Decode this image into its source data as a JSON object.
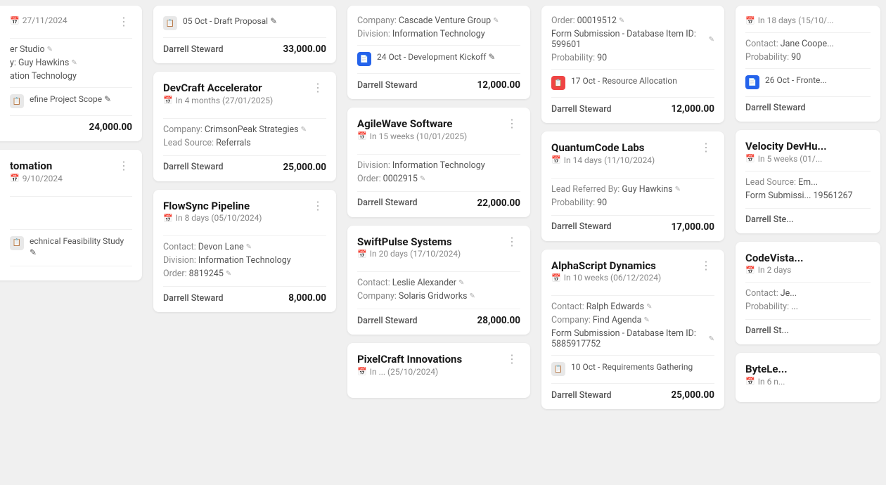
{
  "columns": [
    {
      "id": "col1",
      "partial": "left",
      "cards": [
        {
          "id": "c1",
          "title": "...",
          "subtitle": "27/11/2024",
          "fields": [
            {
              "label": "er Studio",
              "edit": true
            },
            {
              "label": "y: Guy Hawkins",
              "edit": true
            },
            {
              "label": "ation Technology"
            }
          ],
          "activity": [],
          "activities": [
            {
              "icon": "gray",
              "text": "efine Project Scope",
              "edit": true
            }
          ],
          "owner": "",
          "amount": "24,000.00",
          "more": true
        },
        {
          "id": "c2",
          "title": "tomation",
          "subtitle": "9/10/2024",
          "fields": [],
          "activities": [
            {
              "icon": "gray",
              "text": "echnical Feasibility Study",
              "edit": true
            }
          ],
          "owner": "",
          "amount": "",
          "more": true
        }
      ]
    },
    {
      "id": "col2",
      "partial": "none",
      "cards": [
        {
          "id": "c3",
          "title": "...",
          "subtitle": "",
          "activities": [
            {
              "icon": "gray",
              "text": "05 Oct - Draft Proposal",
              "edit": true
            }
          ],
          "fields": [],
          "owner": "Darrell Steward",
          "amount": "33,000.00",
          "more": false
        },
        {
          "id": "c4",
          "title": "DevCraft Accelerator",
          "subtitle": "In 4 months (27/01/2025)",
          "subtitleIcon": "calendar",
          "fields": [
            {
              "label": "Company:",
              "value": "CrimsonPeak Strategies",
              "edit": true
            },
            {
              "label": "Lead Source:",
              "value": "Referrals",
              "edit": false
            }
          ],
          "activities": [],
          "owner": "Darrell Steward",
          "amount": "25,000.00",
          "more": true
        },
        {
          "id": "c5",
          "title": "FlowSync Pipeline",
          "subtitle": "In 8 days (05/10/2024)",
          "subtitleIcon": "calendar",
          "fields": [
            {
              "label": "Contact:",
              "value": "Devon Lane",
              "edit": true
            },
            {
              "label": "Division:",
              "value": "Information Technology",
              "edit": false
            },
            {
              "label": "Order:",
              "value": "8819245",
              "edit": true
            }
          ],
          "activities": [],
          "owner": "Darrell Steward",
          "amount": "8,000.00",
          "more": true
        }
      ]
    },
    {
      "id": "col3",
      "partial": "none",
      "cards": [
        {
          "id": "c6",
          "title": "...",
          "subtitle": "",
          "fields": [
            {
              "label": "Company:",
              "value": "Cascade Venture Group",
              "edit": true
            },
            {
              "label": "Division:",
              "value": "Information Technology",
              "edit": false
            }
          ],
          "activities": [
            {
              "icon": "blue",
              "text": "24 Oct - Development Kickoff",
              "edit": true
            }
          ],
          "owner": "Darrell Steward",
          "amount": "12,000.00",
          "more": false
        },
        {
          "id": "c7",
          "title": "AgileWave Software",
          "subtitle": "In 15 weeks (10/01/2025)",
          "subtitleIcon": "calendar",
          "fields": [
            {
              "label": "Division:",
              "value": "Information Technology",
              "edit": false
            },
            {
              "label": "Order:",
              "value": "0002915",
              "edit": true
            }
          ],
          "activities": [],
          "owner": "Darrell Steward",
          "amount": "22,000.00",
          "more": true
        },
        {
          "id": "c8",
          "title": "SwiftPulse Systems",
          "subtitle": "In 20 days (17/10/2024)",
          "subtitleIcon": "calendar",
          "fields": [
            {
              "label": "Contact:",
              "value": "Leslie Alexander",
              "edit": true
            },
            {
              "label": "Company:",
              "value": "Solaris Gridworks",
              "edit": true
            }
          ],
          "activities": [],
          "owner": "Darrell Steward",
          "amount": "28,000.00",
          "more": true
        },
        {
          "id": "c9",
          "title": "PixelCraft Innovations",
          "subtitle": "In (25/10/2024)",
          "subtitleIcon": "calendar",
          "fields": [],
          "activities": [],
          "owner": "...",
          "amount": "",
          "more": true
        }
      ]
    },
    {
      "id": "col4",
      "partial": "none",
      "cards": [
        {
          "id": "c10",
          "title": "...",
          "subtitle": "",
          "fields": [
            {
              "label": "Order:",
              "value": "00019512",
              "edit": true
            },
            {
              "label": "Form Submission - Database Item ID:",
              "value": "599601",
              "edit": true
            },
            {
              "label": "Probability:",
              "value": "90",
              "edit": false
            }
          ],
          "activities": [
            {
              "icon": "red",
              "text": "17 Oct - Resource Allocation",
              "edit": false
            }
          ],
          "owner": "Darrell Steward",
          "amount": "12,000.00",
          "more": false
        },
        {
          "id": "c11",
          "title": "QuantumCode Labs",
          "subtitle": "In 14 days (11/10/2024)",
          "subtitleIcon": "calendar",
          "fields": [
            {
              "label": "Lead Referred By:",
              "value": "Guy Hawkins",
              "edit": true
            },
            {
              "label": "Probability:",
              "value": "90",
              "edit": false
            }
          ],
          "activities": [],
          "owner": "Darrell Steward",
          "amount": "17,000.00",
          "more": true
        },
        {
          "id": "c12",
          "title": "AlphaScript Dynamics",
          "subtitle": "In 10 weeks (06/12/2024)",
          "subtitleIcon": "calendar",
          "fields": [
            {
              "label": "Contact:",
              "value": "Ralph Edwards",
              "edit": true
            },
            {
              "label": "Company:",
              "value": "Find Agenda",
              "edit": true
            },
            {
              "label": "Form Submission - Database Item ID:",
              "value": "5885917752",
              "edit": true
            }
          ],
          "activities": [
            {
              "icon": "gray",
              "text": "10 Oct - Requirements Gathering",
              "edit": false
            }
          ],
          "owner": "Darrell Steward",
          "amount": "25,000.00",
          "more": true
        }
      ]
    },
    {
      "id": "col5",
      "partial": "right",
      "cards": [
        {
          "id": "c13",
          "title": "...",
          "subtitle": "In 18 days (15/10/...",
          "subtitleIcon": "calendar",
          "fields": [
            {
              "label": "Contact:",
              "value": "Jane Coope...",
              "edit": false
            },
            {
              "label": "Probability:",
              "value": "90",
              "edit": false
            }
          ],
          "activities": [
            {
              "icon": "blue",
              "text": "26 Oct - Fronte...",
              "edit": false
            }
          ],
          "owner": "Darrell Steward",
          "amount": "",
          "more": false
        },
        {
          "id": "c14",
          "title": "Velocity DevH...",
          "subtitle": "In 5 weeks (01/...",
          "subtitleIcon": "calendar",
          "fields": [
            {
              "label": "Lead Source:",
              "value": "Em...",
              "edit": false
            },
            {
              "label": "Form Submissi...",
              "value": "19561267",
              "edit": false
            }
          ],
          "activities": [],
          "owner": "Darrell Ste...",
          "amount": "",
          "more": false
        },
        {
          "id": "c15",
          "title": "CodeVista...",
          "subtitle": "In 2 days",
          "subtitleIcon": "calendar",
          "fields": [
            {
              "label": "Contact:",
              "value": "Je...",
              "edit": false
            },
            {
              "label": "Probability:",
              "value": "...",
              "edit": false
            }
          ],
          "activities": [],
          "owner": "Darrell St...",
          "amount": "",
          "more": false
        },
        {
          "id": "c16",
          "title": "ByteLe...",
          "subtitle": "In 6 n...",
          "subtitleIcon": "calendar",
          "fields": [],
          "activities": [],
          "owner": "",
          "amount": "",
          "more": false
        }
      ]
    }
  ]
}
